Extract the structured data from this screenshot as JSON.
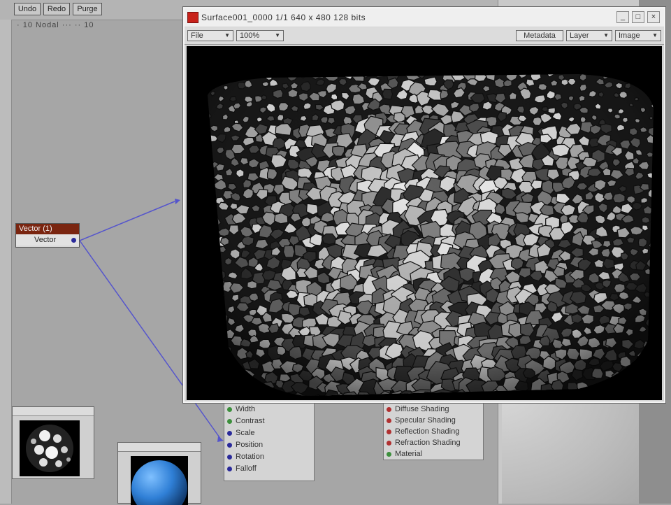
{
  "toolbar": {
    "undo_label": "Undo",
    "redo_label": "Redo",
    "purge_label": "Purge",
    "subtitle": "· 10 Nodal ··· ·· 10"
  },
  "vector_node": {
    "title": "Vector (1)",
    "output_label": "Vector"
  },
  "input_ports": [
    {
      "label": "Width",
      "color": "#3c8f3c"
    },
    {
      "label": "Contrast",
      "color": "#3c8f3c"
    },
    {
      "label": "Scale",
      "color": "#2a2a9a"
    },
    {
      "label": "Position",
      "color": "#2a2a9a"
    },
    {
      "label": "Rotation",
      "color": "#2a2a9a"
    },
    {
      "label": "Falloff",
      "color": "#2a2a9a"
    }
  ],
  "shading_ports": [
    {
      "label": "Diffuse Shading",
      "color": "#b03030"
    },
    {
      "label": "Specular Shading",
      "color": "#b03030"
    },
    {
      "label": "Reflection Shading",
      "color": "#b03030"
    },
    {
      "label": "Refraction Shading",
      "color": "#b03030"
    },
    {
      "label": "Material",
      "color": "#3c8f3c"
    }
  ],
  "viewer": {
    "title": "Surface001_0000 1/1 640 x 480 128 bits",
    "file_menu": "File",
    "zoom": "100%",
    "metadata_label": "Metadata",
    "layer_menu": "Layer",
    "image_menu": "Image"
  },
  "colors": {
    "node_title": "#7a2510",
    "connection": "#5555cc",
    "sphere_blue": "#2f7fd6"
  }
}
